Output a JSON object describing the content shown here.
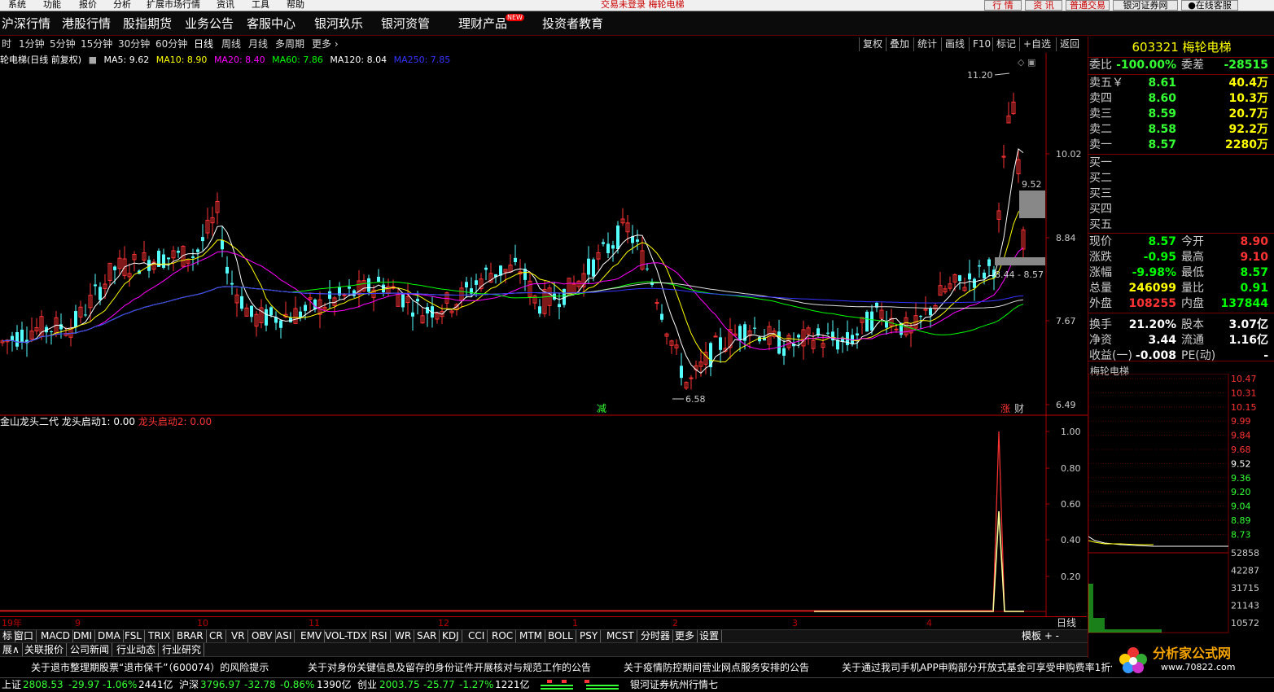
{
  "menubar": {
    "items": [
      "系统",
      "功能",
      "报价",
      "分析",
      "扩展市场行情",
      "资讯",
      "工具",
      "帮助"
    ],
    "title": "交易未登录  梅轮电梯",
    "buttons": [
      "行 情",
      "资 讯",
      "普通交易",
      "银河证券网",
      "在线客服"
    ]
  },
  "navbar": {
    "items": [
      "沪深行情",
      "港股行情",
      "股指期货",
      "业务公告",
      "客服中心",
      "银河玖乐",
      "银河资管",
      "理财产品",
      "投资者教育"
    ],
    "badge": "NEW"
  },
  "periods": [
    "时",
    "1分钟",
    "5分钟",
    "15分钟",
    "30分钟",
    "60分钟",
    "日线",
    "周线",
    "月线",
    "多周期",
    "更多 ›"
  ],
  "active_period": "日线",
  "toolbar": [
    "复权",
    "叠加",
    "统计",
    "画线",
    "F10",
    "标记",
    "+自选",
    "返回"
  ],
  "legend": {
    "name": "轮电梯(日线 前复权)",
    "ma": [
      {
        "label": "MA5: 9.62",
        "color": "#ffffff"
      },
      {
        "label": "MA10: 8.90",
        "color": "#ffff00"
      },
      {
        "label": "MA20: 8.40",
        "color": "#ff00ff"
      },
      {
        "label": "MA60: 7.86",
        "color": "#00ff00"
      },
      {
        "label": "MA120: 8.04",
        "color": "#ffffff"
      },
      {
        "label": "MA250: 7.85",
        "color": "#0000ff"
      }
    ]
  },
  "price_axis": [
    "10.02",
    "8.84",
    "7.67",
    "6.49"
  ],
  "price_annotations": {
    "high": "11.20",
    "low": "6.58",
    "right_upper": "9.52",
    "right_lower": "8.44 - 8.57"
  },
  "markers": {
    "reduce": "减",
    "rise": "涨",
    "finance": "财"
  },
  "indicator": {
    "name": "金山龙头二代",
    "line1": "龙头启动1: 0.00",
    "line2": "龙头启动2: 0.00",
    "axis": [
      "1.00",
      "0.80",
      "0.60",
      "0.40",
      "0.20"
    ]
  },
  "dates": [
    "19年",
    "9",
    "10",
    "11",
    "12",
    "1",
    "2",
    "3",
    "4"
  ],
  "period_corner": "日线",
  "indicator_tabs": [
    "标",
    "窗口",
    "MACD",
    "DMI",
    "DMA",
    "FSL",
    "TRIX",
    "BRAR",
    "CR",
    "VR",
    "OBV",
    "ASI",
    "EMV",
    "VOL-TDX",
    "RSI",
    "WR",
    "SAR",
    "KDJ",
    "CCI",
    "ROC",
    "MTM",
    "BOLL",
    "PSY",
    "MCST",
    "分时器",
    "更多",
    "设置"
  ],
  "template_btn": "模板  +  -",
  "subtabs": [
    "展∧",
    "关联报价",
    "公司新闻",
    "行业动态",
    "行业研究"
  ],
  "ticker": [
    "关于退市整理期股票“退市保千”（600074）的风险提示",
    "关于对身份关键信息及留存的身份证件开展核对与规范工作的公告",
    "关于疫情防控期间营业网点服务安排的公告",
    "关于通过我司手机APP申购部分开放式基金可享受申购费率1折优惠"
  ],
  "status": {
    "sh": {
      "name": "上证",
      "val": "2808.53",
      "chg": "-29.97",
      "pct": "-1.06%",
      "amt": "2441亿"
    },
    "sz": {
      "name": "沪深",
      "val": "3796.97",
      "chg": "-32.78",
      "pct": "-0.86%",
      "amt": "1390亿"
    },
    "cy": {
      "name": "创业",
      "val": "2003.75",
      "chg": "-25.77",
      "pct": "-1.27%",
      "amt": "1221亿"
    },
    "server": "银河证券杭州行情七"
  },
  "quote": {
    "code_name": "603321 梅轮电梯",
    "wb": {
      "label": "委比",
      "val": "-100.00%",
      "label2": "委差",
      "val2": "-28515"
    },
    "asks": [
      {
        "label": "卖五￥",
        "price": "8.61",
        "vol": "40.4万"
      },
      {
        "label": "卖四",
        "price": "8.60",
        "vol": "10.3万"
      },
      {
        "label": "卖三",
        "price": "8.59",
        "vol": "20.7万"
      },
      {
        "label": "卖二",
        "price": "8.58",
        "vol": "92.2万"
      },
      {
        "label": "卖一",
        "price": "8.57",
        "vol": "2280万"
      }
    ],
    "bids": [
      "买一",
      "买二",
      "买三",
      "买四",
      "买五"
    ],
    "stats": [
      {
        "l1": "现价",
        "v1": "8.57",
        "c1": "#00ff00",
        "l2": "今开",
        "v2": "8.90",
        "c2": "#ff3333"
      },
      {
        "l1": "涨跌",
        "v1": "-0.95",
        "c1": "#00ff00",
        "l2": "最高",
        "v2": "9.10",
        "c2": "#ff3333"
      },
      {
        "l1": "涨幅",
        "v1": "-9.98%",
        "c1": "#00ff00",
        "l2": "最低",
        "v2": "8.57",
        "c2": "#00ff00"
      },
      {
        "l1": "总量",
        "v1": "246099",
        "c1": "#ffff00",
        "l2": "量比",
        "v2": "0.91",
        "c2": "#00ff00"
      },
      {
        "l1": "外盘",
        "v1": "108255",
        "c1": "#ff3333",
        "l2": "内盘",
        "v2": "137844",
        "c2": "#00ff00"
      },
      {
        "l1": "换手",
        "v1": "21.20%",
        "c1": "#ffffff",
        "l2": "股本",
        "v2": "3.07亿",
        "c2": "#ffffff"
      },
      {
        "l1": "净资",
        "v1": "3.44",
        "c1": "#ffffff",
        "l2": "流通",
        "v2": "1.16亿",
        "c2": "#ffffff"
      },
      {
        "l1": "收益(一)",
        "v1": "-0.008",
        "c1": "#ffffff",
        "l2": "PE(动)",
        "v2": "-",
        "c2": "#ffffff"
      }
    ]
  },
  "mini_chart": {
    "title": "梅轮电梯",
    "price_axis": [
      "10.47",
      "10.31",
      "10.15",
      "9.99",
      "9.84",
      "9.68",
      "9.52",
      "9.36",
      "9.20",
      "9.04",
      "8.89",
      "8.73"
    ],
    "vol_axis": [
      "52858",
      "42287",
      "31715",
      "21143",
      "10572"
    ]
  },
  "logo": {
    "name": "分析家公式网",
    "url": "www.70822.com"
  },
  "colors": {
    "up": "#ff3333",
    "down": "#54ffff",
    "bg": "#000000",
    "grid": "#700000"
  }
}
